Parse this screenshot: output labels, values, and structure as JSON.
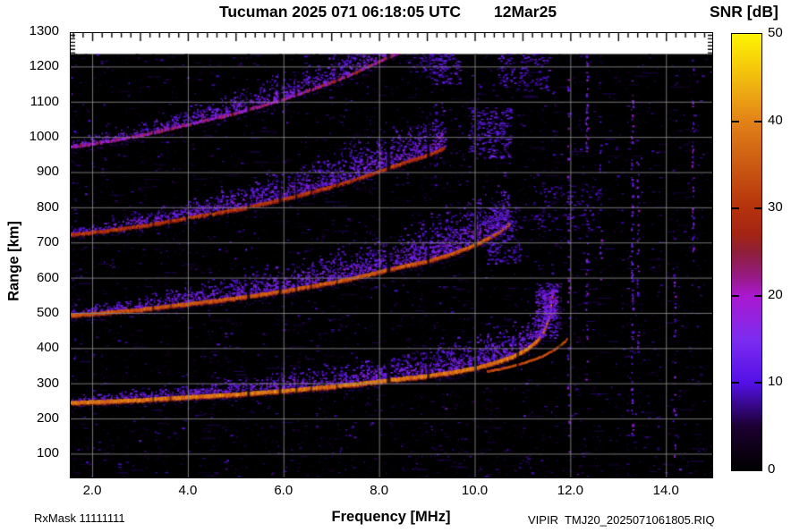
{
  "title": {
    "main": "Tucuman 2025 071 06:18:05 UTC",
    "date": "12Mar25"
  },
  "colorbar": {
    "title": "SNR [dB]",
    "min": 0,
    "max": 50,
    "tick_labels": [
      "0",
      "10",
      "20",
      "30",
      "40",
      "50"
    ],
    "tick_values": [
      0,
      10,
      20,
      30,
      40,
      50
    ],
    "bar_dash_values": [
      10,
      20,
      30,
      40
    ],
    "stops": [
      [
        0,
        "#000000"
      ],
      [
        0.1,
        "#1c0030"
      ],
      [
        0.2,
        "#5310e6"
      ],
      [
        0.3,
        "#7c2cf0"
      ],
      [
        0.4,
        "#aa18cf"
      ],
      [
        0.44,
        "#971a8a"
      ],
      [
        0.5,
        "#8e1f3a"
      ],
      [
        0.54,
        "#a42414"
      ],
      [
        0.6,
        "#b5320c"
      ],
      [
        0.7,
        "#cb5a12"
      ],
      [
        0.8,
        "#e28219"
      ],
      [
        0.9,
        "#f2bc0e"
      ],
      [
        1,
        "#fdf403"
      ]
    ]
  },
  "axes": {
    "x": {
      "label": "Frequency [MHz]",
      "min": 1.55,
      "max": 14.95,
      "tick_values": [
        2,
        4,
        6,
        8,
        10,
        12,
        14
      ],
      "tick_labels": [
        "2.0",
        "4.0",
        "6.0",
        "8.0",
        "10.0",
        "12.0",
        "14.0"
      ],
      "minor_step": 0.2,
      "major_step": 1.0,
      "grid_step": 2
    },
    "y": {
      "label": "Range [km]",
      "min": 35,
      "max": 1295,
      "tick_values": [
        1300,
        1200,
        1100,
        1000,
        900,
        800,
        700,
        600,
        500,
        400,
        300,
        200,
        100
      ],
      "tick_labels": [
        "1300",
        "1200",
        "1100",
        "1000",
        "900",
        "800",
        "700",
        "600",
        "500",
        "400",
        "300",
        "200",
        "100"
      ],
      "minor_step": 10,
      "grid_step": 100,
      "data_top": 1236
    }
  },
  "footer": {
    "rxmask": "RxMask 11111111",
    "file": "VIPIR  TMJ20_2025071061805.RIQ"
  },
  "chart_data": {
    "type": "heatmap",
    "variant": "ionogram",
    "title": "Tucuman 2025 071 06:18:05 UTC   12Mar25",
    "xlabel": "Frequency [MHz]",
    "ylabel": "Range [km]",
    "zlabel": "SNR [dB]",
    "xlim": [
      1.55,
      14.95
    ],
    "ylim": [
      35,
      1295
    ],
    "zlim": [
      0,
      50
    ],
    "grid": {
      "x_step_mhz": 2,
      "y_step_km": 100,
      "grid_on": true
    },
    "critical_frequency_mhz": 11.6,
    "first_hop_virtual_range": {
      "frequency_mhz": [
        1.55,
        2,
        2.5,
        3,
        3.5,
        4,
        4.5,
        5,
        5.5,
        6,
        6.5,
        7,
        7.5,
        8,
        8.5,
        9,
        9.5,
        10,
        10.4,
        10.8,
        11.1,
        11.3,
        11.45,
        11.55,
        11.62
      ],
      "range_km": [
        244,
        246,
        249,
        252,
        256,
        260,
        264,
        268,
        273,
        278,
        284,
        290,
        297,
        305,
        313,
        320,
        330,
        343,
        357,
        376,
        398,
        420,
        450,
        490,
        550
      ]
    },
    "echo_hops": [
      {
        "hop": 1,
        "range_at_2mhz_km": 246,
        "visible_to_mhz": 11.62,
        "peak_snr_db": 42
      },
      {
        "hop": 2,
        "range_at_2mhz_km": 497,
        "visible_to_mhz": 10.72,
        "peak_snr_db": 38
      },
      {
        "hop": 3,
        "range_at_2mhz_km": 745,
        "visible_to_mhz": 9.35,
        "peak_snr_db": 34
      },
      {
        "hop": 4,
        "range_at_2mhz_km": 995,
        "visible_to_mhz": 8.85,
        "peak_snr_db": 27
      }
    ],
    "render": {
      "seed": 20250712,
      "noise": {
        "cell_prob": 0.13,
        "snr_lo": 2,
        "snr_hi": 12,
        "streaks": 420,
        "left_edge_boost": 3
      },
      "hops": [
        {
          "mult": 1.0,
          "f_end": 11.62,
          "core_w": 4,
          "snr": [
            34,
            42
          ],
          "cloud": [
            5,
            40
          ],
          "cloud_d": 0.5,
          "underline": true
        },
        {
          "mult": 2.02,
          "f_end": 10.72,
          "core_w": 3.5,
          "snr": [
            31,
            38
          ],
          "cloud": [
            7,
            52
          ],
          "cloud_d": 0.48,
          "underline": true
        },
        {
          "mult": 2.96,
          "f_end": 9.35,
          "core_w": 3,
          "snr": [
            26,
            34
          ],
          "cloud": [
            7,
            48
          ],
          "cloud_d": 0.44,
          "underline": true
        },
        {
          "mult": 3.98,
          "f_end": 9.2,
          "core_w": 3,
          "snr": [
            15,
            27
          ],
          "cloud": [
            7,
            42
          ],
          "cloud_d": 0.38,
          "underline": false
        }
      ],
      "x_branch": {
        "f0": 10.25,
        "f1": 11.93,
        "shift": 0.58,
        "w": 2.5,
        "snr": [
          29,
          36
        ]
      },
      "diffuse_patches": [
        {
          "f0": 11.26,
          "f1": 11.74,
          "v0": 430,
          "v1": 585,
          "d": 0.5,
          "s": 14
        },
        {
          "f0": 11.42,
          "f1": 11.66,
          "v0": 480,
          "v1": 560,
          "d": 0.6,
          "s": 16
        },
        {
          "f0": 10.25,
          "f1": 10.92,
          "v0": 640,
          "v1": 805,
          "d": 0.33,
          "s": 12
        },
        {
          "f0": 11.2,
          "f1": 12.6,
          "v0": 735,
          "v1": 865,
          "d": 0.14,
          "s": 10
        },
        {
          "f0": 9.85,
          "f1": 10.72,
          "v0": 940,
          "v1": 1085,
          "d": 0.3,
          "s": 12
        },
        {
          "f0": 10.45,
          "f1": 11.5,
          "v0": 1130,
          "v1": 1240,
          "d": 0.22,
          "s": 11
        },
        {
          "f0": 9.0,
          "f1": 9.65,
          "v0": 1150,
          "v1": 1245,
          "d": 0.3,
          "s": 12
        },
        {
          "f0": 8.6,
          "f1": 9.4,
          "v0": 1185,
          "v1": 1250,
          "d": 0.25,
          "s": 11
        }
      ],
      "rfi": [
        {
          "f": 12.33,
          "v0": 950,
          "v1": 1235,
          "d": 0.5
        },
        {
          "f": 12.33,
          "v0": 300,
          "v1": 750,
          "d": 0.2
        },
        {
          "f": 13.28,
          "v0": 150,
          "v1": 1160,
          "d": 0.33
        },
        {
          "f": 13.4,
          "v0": 380,
          "v1": 930,
          "d": 0.25
        },
        {
          "f": 14.17,
          "v0": 80,
          "v1": 640,
          "d": 0.28
        },
        {
          "f": 14.55,
          "v0": 650,
          "v1": 1230,
          "d": 0.26
        },
        {
          "f": 11.95,
          "v0": 60,
          "v1": 1230,
          "d": 0.12
        },
        {
          "f": 12.62,
          "v0": 500,
          "v1": 1100,
          "d": 0.15
        }
      ],
      "dropouts": [
        {
          "f": 3.28,
          "w": 2,
          "a": 0.6
        },
        {
          "f": 3.64,
          "w": 2,
          "a": 0.5
        },
        {
          "f": 5.27,
          "w": 3,
          "a": 0.8
        },
        {
          "f": 5.93,
          "w": 3,
          "a": 0.75
        },
        {
          "f": 6.27,
          "w": 2,
          "a": 0.7
        },
        {
          "f": 6.58,
          "w": 2,
          "a": 0.6
        },
        {
          "f": 7.12,
          "w": 2,
          "a": 0.6
        },
        {
          "f": 8.2,
          "w": 4,
          "a": 0.8
        },
        {
          "f": 9.03,
          "w": 3,
          "a": 0.7
        },
        {
          "f": 10.02,
          "w": 3,
          "a": 0.7
        },
        {
          "f": 10.9,
          "w": 3,
          "a": 0.65
        },
        {
          "f": 11.78,
          "w": 3,
          "a": 0.5
        }
      ],
      "gridline_color": "rgba(138,138,138,0.85)"
    }
  }
}
